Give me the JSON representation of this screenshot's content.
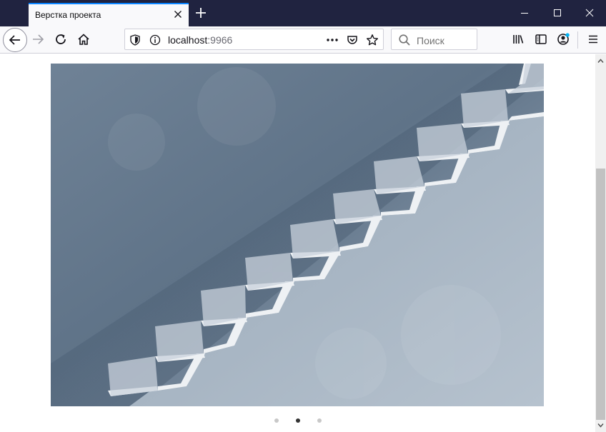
{
  "browser": {
    "tab_title": "Верстка проекта",
    "url_host": "localhost",
    "url_port": ":9966",
    "search_placeholder": "Поиск",
    "accent_color": "#0a84ff",
    "titlebar_color": "#202340"
  },
  "toolbar": {
    "icons": [
      "back-arrow-icon",
      "forward-arrow-icon",
      "reload-icon",
      "home-icon",
      "shield-icon",
      "info-icon",
      "more-dots-icon",
      "pocket-icon",
      "star-icon",
      "search-icon",
      "library-icon",
      "sidebar-icon",
      "account-icon",
      "menu-icon"
    ]
  },
  "page": {
    "slider": {
      "slide_count": 3,
      "active_index": 1,
      "image_subject": "white stairs on grey-blue wall"
    }
  }
}
